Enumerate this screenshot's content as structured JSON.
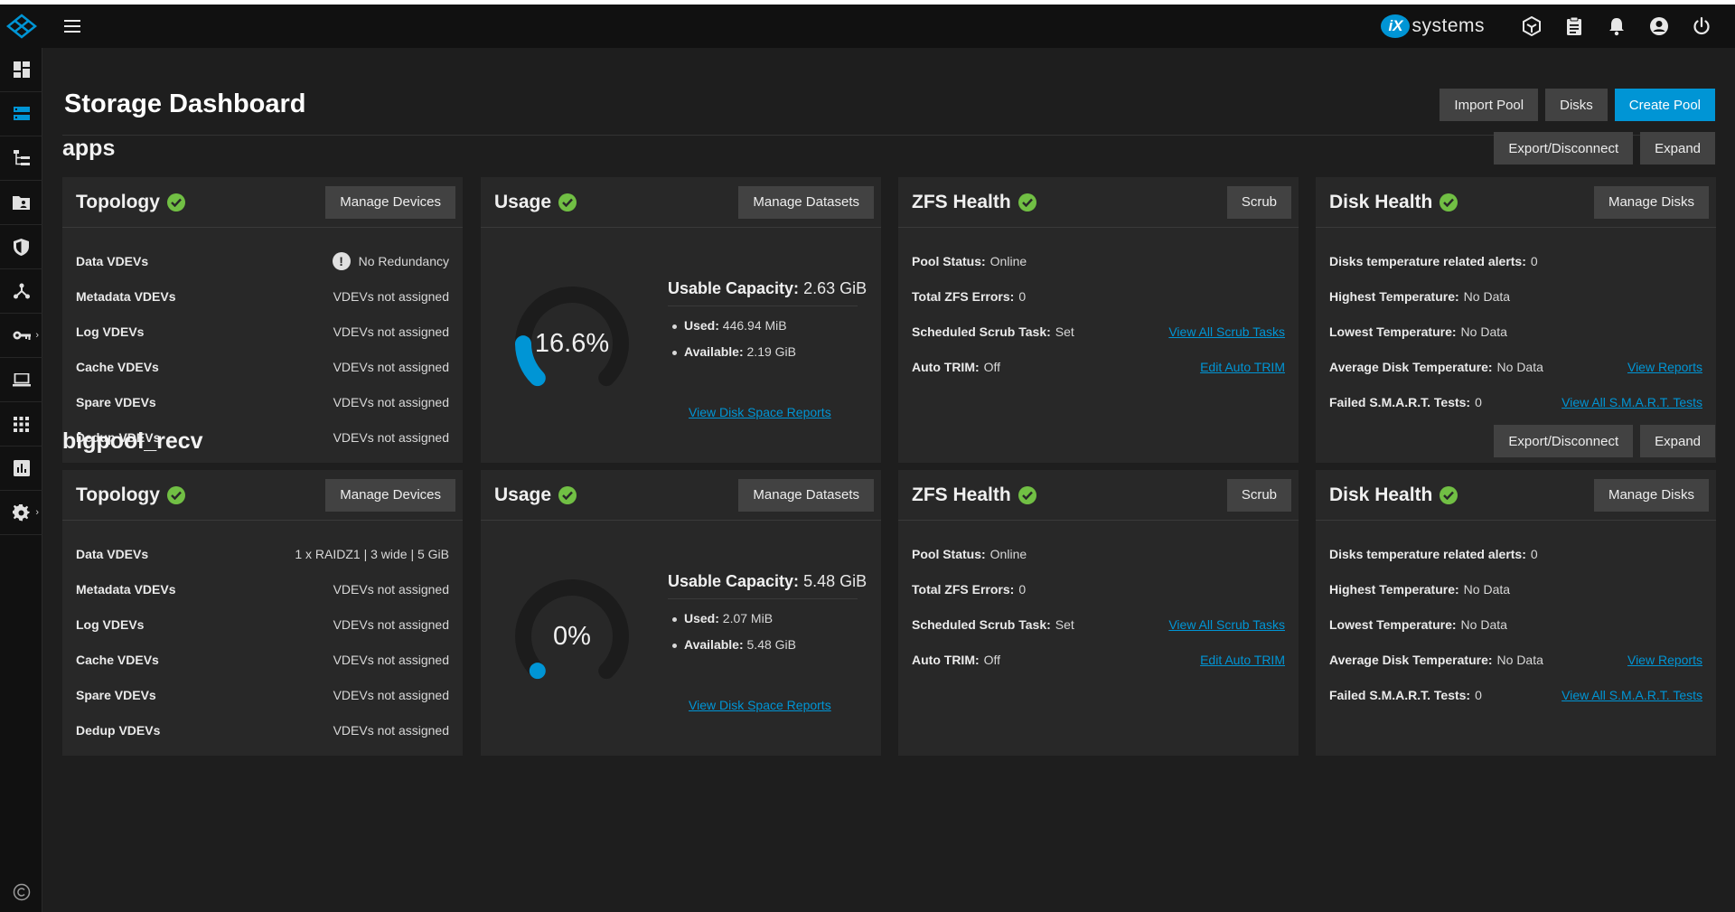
{
  "header": {
    "brand_mark": "iX",
    "brand_name": "systems"
  },
  "page": {
    "title": "Storage Dashboard",
    "buttons": {
      "import_pool": "Import Pool",
      "disks": "Disks",
      "create_pool": "Create Pool"
    }
  },
  "colors": {
    "accent": "#0095d5",
    "ok": "#71bf44",
    "background": "#1e1e1e",
    "card": "#282828"
  },
  "pools": [
    {
      "name": "apps",
      "export_label": "Export/Disconnect",
      "expand_label": "Expand",
      "topology": {
        "title": "Topology",
        "button": "Manage Devices",
        "rows": [
          {
            "label": "Data VDEVs",
            "value": "No Redundancy"
          },
          {
            "label": "Metadata VDEVs",
            "value": "VDEVs not assigned"
          },
          {
            "label": "Log VDEVs",
            "value": "VDEVs not assigned"
          },
          {
            "label": "Cache VDEVs",
            "value": "VDEVs not assigned"
          },
          {
            "label": "Spare VDEVs",
            "value": "VDEVs not assigned"
          },
          {
            "label": "Dedup VDEVs",
            "value": "VDEVs not assigned"
          }
        ]
      },
      "usage": {
        "title": "Usage",
        "button": "Manage Datasets",
        "percent_text": "16.6%",
        "percent": 16.6,
        "capacity_label": "Usable Capacity:",
        "capacity_value": "2.63 GiB",
        "used_label": "Used:",
        "used_value": "446.94 MiB",
        "available_label": "Available:",
        "available_value": "2.19 GiB",
        "report_link": "View Disk Space Reports"
      },
      "zfs": {
        "title": "ZFS Health",
        "button": "Scrub",
        "pool_status_label": "Pool Status:",
        "pool_status_value": "Online",
        "errors_label": "Total ZFS Errors:",
        "errors_value": "0",
        "scrub_label": "Scheduled Scrub Task:",
        "scrub_value": "Set",
        "scrub_link": "View All Scrub Tasks",
        "trim_label": "Auto TRIM:",
        "trim_value": "Off",
        "trim_link": "Edit Auto TRIM"
      },
      "disk": {
        "title": "Disk Health",
        "button": "Manage Disks",
        "temp_alerts_label": "Disks temperature related alerts:",
        "temp_alerts_value": "0",
        "highest_label": "Highest Temperature:",
        "highest_value": "No Data",
        "lowest_label": "Lowest Temperature:",
        "lowest_value": "No Data",
        "avg_label": "Average Disk Temperature:",
        "avg_value": "No Data",
        "reports_link": "View Reports",
        "smart_label": "Failed S.M.A.R.T. Tests:",
        "smart_value": "0",
        "smart_link": "View All S.M.A.R.T. Tests"
      }
    },
    {
      "name": "bigpool_recv",
      "export_label": "Export/Disconnect",
      "expand_label": "Expand",
      "topology": {
        "title": "Topology",
        "button": "Manage Devices",
        "rows": [
          {
            "label": "Data VDEVs",
            "value": "1 x RAIDZ1 | 3 wide | 5 GiB"
          },
          {
            "label": "Metadata VDEVs",
            "value": "VDEVs not assigned"
          },
          {
            "label": "Log VDEVs",
            "value": "VDEVs not assigned"
          },
          {
            "label": "Cache VDEVs",
            "value": "VDEVs not assigned"
          },
          {
            "label": "Spare VDEVs",
            "value": "VDEVs not assigned"
          },
          {
            "label": "Dedup VDEVs",
            "value": "VDEVs not assigned"
          }
        ]
      },
      "usage": {
        "title": "Usage",
        "button": "Manage Datasets",
        "percent_text": "0%",
        "percent": 0,
        "capacity_label": "Usable Capacity:",
        "capacity_value": "5.48 GiB",
        "used_label": "Used:",
        "used_value": "2.07 MiB",
        "available_label": "Available:",
        "available_value": "5.48 GiB",
        "report_link": "View Disk Space Reports"
      },
      "zfs": {
        "title": "ZFS Health",
        "button": "Scrub",
        "pool_status_label": "Pool Status:",
        "pool_status_value": "Online",
        "errors_label": "Total ZFS Errors:",
        "errors_value": "0",
        "scrub_label": "Scheduled Scrub Task:",
        "scrub_value": "Set",
        "scrub_link": "View All Scrub Tasks",
        "trim_label": "Auto TRIM:",
        "trim_value": "Off",
        "trim_link": "Edit Auto TRIM"
      },
      "disk": {
        "title": "Disk Health",
        "button": "Manage Disks",
        "temp_alerts_label": "Disks temperature related alerts:",
        "temp_alerts_value": "0",
        "highest_label": "Highest Temperature:",
        "highest_value": "No Data",
        "lowest_label": "Lowest Temperature:",
        "lowest_value": "No Data",
        "avg_label": "Average Disk Temperature:",
        "avg_value": "No Data",
        "reports_link": "View Reports",
        "smart_label": "Failed S.M.A.R.T. Tests:",
        "smart_value": "0",
        "smart_link": "View All S.M.A.R.T. Tests"
      }
    }
  ]
}
